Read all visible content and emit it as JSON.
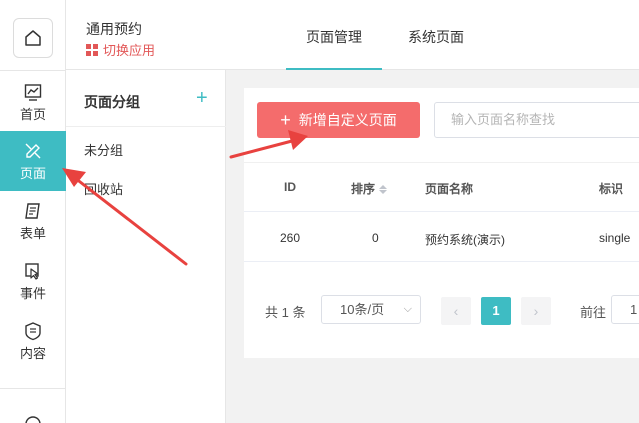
{
  "rail": {
    "items": [
      {
        "label": "首页",
        "icon": "chart-icon"
      },
      {
        "label": "页面",
        "icon": "page-edit-icon",
        "active": true
      },
      {
        "label": "表单",
        "icon": "form-icon"
      },
      {
        "label": "事件",
        "icon": "event-icon"
      },
      {
        "label": "内容",
        "icon": "content-icon"
      }
    ]
  },
  "header": {
    "app_name": "通用预约",
    "switch_app": "切换应用",
    "tabs": [
      {
        "label": "页面管理",
        "active": true
      },
      {
        "label": "系统页面",
        "active": false
      }
    ]
  },
  "groups": {
    "title": "页面分组",
    "add": "+",
    "items": [
      "未分组",
      "回收站"
    ]
  },
  "toolbar": {
    "add_button": "新增自定义页面",
    "search_placeholder": "输入页面名称查找"
  },
  "table": {
    "columns": [
      "ID",
      "排序",
      "页面名称",
      "标识"
    ],
    "rows": [
      {
        "id": "260",
        "sort": "0",
        "name": "预约系统(演示)",
        "flag": "single"
      }
    ]
  },
  "pagination": {
    "total": "共 1 条",
    "page_size": "10条/页",
    "current_page": "1",
    "goto_label": "前往",
    "goto_value": "1"
  },
  "colors": {
    "accent": "#3ebcc3",
    "danger": "#f46c6c",
    "annotation": "#e8423f"
  }
}
